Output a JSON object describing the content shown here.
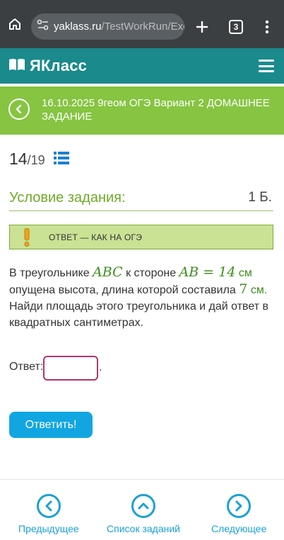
{
  "browser": {
    "url_domain": "yaklass.ru",
    "url_path": "/TestWorkRun/Exerci",
    "tab_count": "3"
  },
  "site": {
    "logo_text": "ЯКласс"
  },
  "title_bar": {
    "title": "16.10.2025 9геом ОГЭ Вариант 2 ДОМАШНЕЕ ЗАДАНИЕ"
  },
  "counter": {
    "current": "14",
    "total": "/19"
  },
  "condition": {
    "heading": "Условие задания:",
    "points": "1 Б."
  },
  "hint": {
    "text": "ОТВЕТ — КАК НА ОГЭ"
  },
  "task": {
    "p1": "В треугольнике ",
    "m1": "ABC",
    "p2": " к стороне ",
    "m2": "AB = 14",
    "u1": " см",
    "p3": "опущена высота, длина которой составила ",
    "m3": "7",
    "u2": " см.",
    "p4": "Найди площадь этого треугольника и дай ответ в квадратных сантиметрах."
  },
  "answer": {
    "label": "Ответ:",
    "value": "",
    "suffix": "."
  },
  "submit": {
    "label": "Ответить!"
  },
  "nav": {
    "prev": "Предыдущее",
    "list": "Список заданий",
    "next": "Следующее"
  },
  "colors": {
    "browser_bar": "#3b3f42",
    "header": "#1a8a8c",
    "title_bar": "#86c441",
    "accent_green": "#70a929",
    "button_blue": "#11a6e2",
    "input_border": "#b3336b"
  }
}
